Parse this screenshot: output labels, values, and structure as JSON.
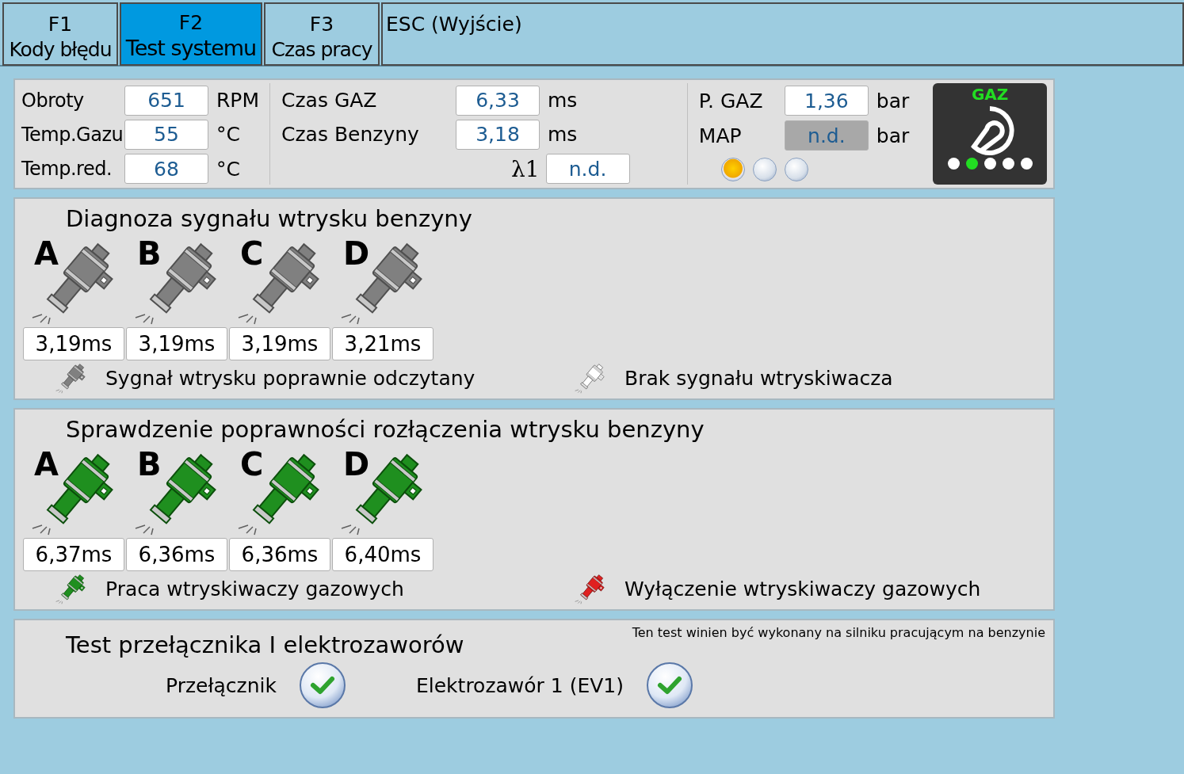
{
  "tabs": [
    {
      "key": "F1",
      "label": "Kody błędu",
      "selected": false
    },
    {
      "key": "F2",
      "label": "Test systemu",
      "selected": true
    },
    {
      "key": "F3",
      "label": "Czas pracy",
      "selected": false
    },
    {
      "key": "ESC (Wyjście)",
      "selected": false
    }
  ],
  "readings": {
    "left": [
      {
        "label": "Obroty",
        "value": "651",
        "unit": "RPM"
      },
      {
        "label": "Temp.Gazu",
        "value": "55",
        "unit": "°C"
      },
      {
        "label": "Temp.red.",
        "value": "68",
        "unit": "°C"
      }
    ],
    "middle": [
      {
        "label": "Czas GAZ",
        "value": "6,33",
        "unit": "ms"
      },
      {
        "label": "Czas Benzyny",
        "value": "3,18",
        "unit": "ms"
      }
    ],
    "lambda": {
      "label": "λ1",
      "value": "n.d."
    },
    "right": [
      {
        "label": "P. GAZ",
        "value": "1,36",
        "unit": "bar",
        "disabled": false
      },
      {
        "label": "MAP",
        "value": "n.d.",
        "unit": "bar",
        "disabled": true
      }
    ],
    "lights": [
      {
        "on": true
      },
      {
        "on": false
      },
      {
        "on": false
      }
    ],
    "gas_badge": {
      "title": "GAZ",
      "dots": [
        {
          "selected": false
        },
        {
          "selected": true
        },
        {
          "selected": false
        },
        {
          "selected": false
        },
        {
          "selected": false
        }
      ]
    }
  },
  "sections": [
    {
      "title": "Diagnoza sygnału wtrysku benzyny",
      "kind": "petrol",
      "injectors": [
        {
          "letter": "A",
          "value": "3,19ms"
        },
        {
          "letter": "B",
          "value": "3,19ms"
        },
        {
          "letter": "C",
          "value": "3,19ms"
        },
        {
          "letter": "D",
          "value": "3,21ms"
        }
      ],
      "legend": [
        {
          "kind": "signal",
          "text": "Sygnał wtrysku poprawnie odczytany"
        },
        {
          "kind": "no-signal",
          "text": "Brak sygnału wtryskiwacza"
        }
      ]
    },
    {
      "title": "Sprawdzenie poprawności rozłączenia wtrysku benzyny",
      "kind": "gas",
      "injectors": [
        {
          "letter": "A",
          "value": "6,37ms"
        },
        {
          "letter": "B",
          "value": "6,36ms"
        },
        {
          "letter": "C",
          "value": "6,36ms"
        },
        {
          "letter": "D",
          "value": "6,40ms"
        }
      ],
      "legend": [
        {
          "kind": "gas-on",
          "text": "Praca wtryskiwaczy gazowych"
        },
        {
          "kind": "gas-off",
          "text": "Wyłączenie wtryskiwaczy gazowych"
        }
      ]
    }
  ],
  "switch_test": {
    "title": "Test przełącznika I elektrozaworów",
    "note": "Ten test winien być wykonany na silniku pracującym na benzynie",
    "items": [
      {
        "label": "Przełącznik",
        "checked": true
      },
      {
        "label": "Elektrozawór 1 (EV1)",
        "checked": true
      }
    ]
  }
}
